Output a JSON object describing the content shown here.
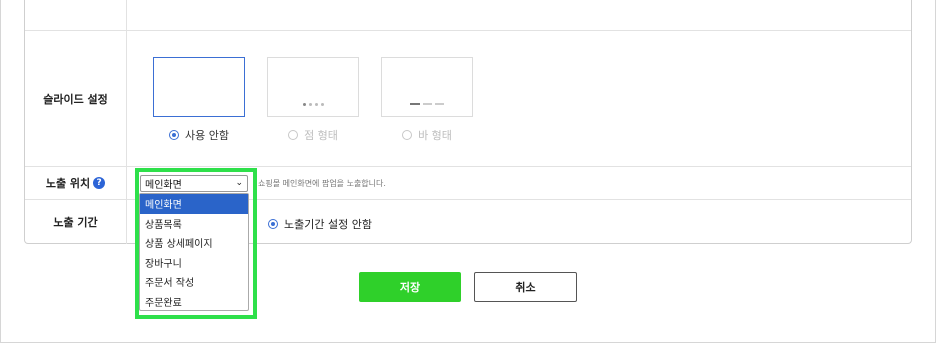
{
  "form": {
    "slide_label": "슬라이드 설정",
    "slide_options": [
      {
        "label": "사용 안함",
        "selected": true
      },
      {
        "label": "점 형태",
        "selected": false
      },
      {
        "label": "바 형태",
        "selected": false
      }
    ],
    "position_label": "노출 위치",
    "position_select_value": "메인화면",
    "position_help": "쇼핑몰 메인화면에 팝업을 노출합니다.",
    "period_label": "노출 기간",
    "period_option": "노출기간 설정 안함"
  },
  "dropdown": {
    "options": [
      "메인화면",
      "상품목록",
      "상품 상세페이지",
      "장바구니",
      "주문서 작성",
      "주문완료"
    ],
    "selected_index": 0
  },
  "actions": {
    "save": "저장",
    "cancel": "취소"
  },
  "colors": {
    "accent": "#2ee04a",
    "save_button": "#2fd02a",
    "selection": "#2a64c9"
  }
}
